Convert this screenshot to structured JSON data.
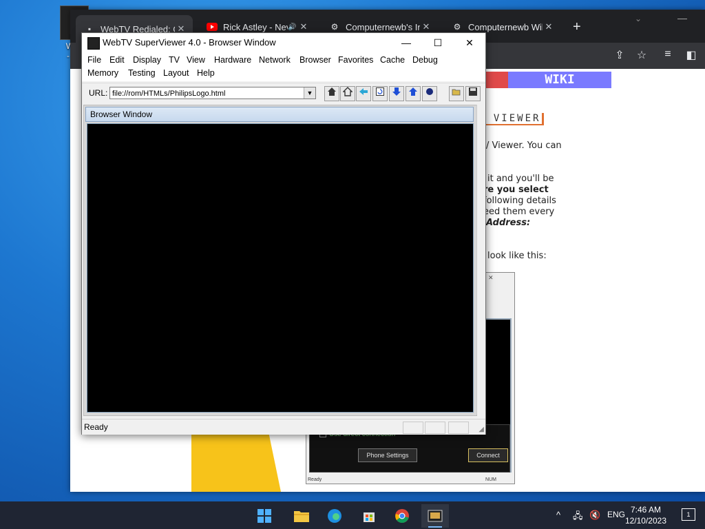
{
  "desktop": {
    "icon_label_line1": "Web",
    "icon_label_line2": "- Sh"
  },
  "chrome": {
    "tabs": [
      {
        "title": "WebTV Redialed: Co",
        "active": true
      },
      {
        "title": "Rick Astley - Nev",
        "playing_audio": true
      },
      {
        "title": "Computernewb's Int"
      },
      {
        "title": "Computernewb Wiki"
      }
    ],
    "close_glyph": "✕",
    "newtab_glyph": "+",
    "wiki": {
      "banner": "WIKI",
      "heading": "E VIEWER",
      "lines": [
        "/ Viewer. You can",
        "it and you'll be",
        "re you select",
        "following details",
        "eed them every",
        "Address:",
        "look like this:"
      ]
    },
    "screenshot": {
      "check_label": "Use direct connection",
      "phone_button": "Phone Settings",
      "connect_button": "Connect",
      "status": "Ready",
      "mode": "NUM"
    }
  },
  "superviewer": {
    "title": "WebTV SuperViewer 4.0 - Browser Window",
    "caption": {
      "minimize": "—",
      "maximize": "☐",
      "close": "✕"
    },
    "menu_row1": [
      "File",
      "Edit",
      "Display",
      "TV",
      "View",
      "Hardware",
      "Network",
      "Browser",
      "Favorites",
      "Cache",
      "Debug"
    ],
    "menu_row2": [
      "Memory",
      "Testing",
      "Layout",
      "Help"
    ],
    "url_label": "URL:",
    "url_value": "file://rom/HTMLs/PhilipsLogo.html",
    "toolbar_icons": [
      "home-tv-icon",
      "home-icon",
      "back-icon",
      "reload-icon",
      "scroll-down-icon",
      "scroll-up-icon",
      "power-icon",
      "open-folder-icon",
      "save-icon"
    ],
    "browser_window_title": "Browser Window",
    "status": "Ready"
  },
  "taskbar": {
    "language": "ENG",
    "time": "7:46 AM",
    "date": "12/10/2023",
    "notifications": "1"
  }
}
